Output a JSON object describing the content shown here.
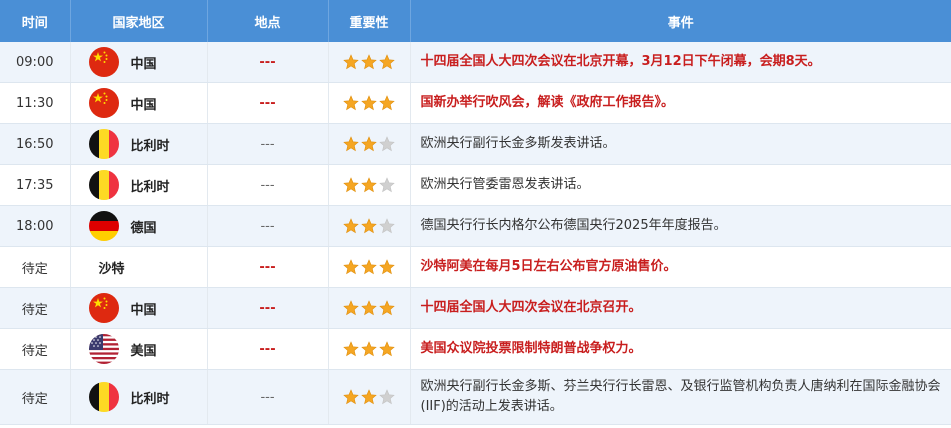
{
  "header": {
    "time": "时间",
    "country": "国家地区",
    "location": "地点",
    "importance": "重要性",
    "event": "事件"
  },
  "colors": {
    "header_bg": "#4a8fd6",
    "highlight_text": "#c81e1e",
    "star_on": "#f5a623",
    "star_off": "#d0d0d0",
    "odd_row": "#eef4fb"
  },
  "rows": [
    {
      "time": "09:00",
      "country": "中国",
      "flag": "china-flag-icon",
      "location": "---",
      "stars": 3,
      "event": "十四届全国人大四次会议在北京开幕，3月12日下午闭幕，会期8天。",
      "highlight": true
    },
    {
      "time": "11:30",
      "country": "中国",
      "flag": "china-flag-icon",
      "location": "---",
      "stars": 3,
      "event": "国新办举行吹风会，解读《政府工作报告》。",
      "highlight": true
    },
    {
      "time": "16:50",
      "country": "比利时",
      "flag": "belgium-flag-icon",
      "location": "---",
      "stars": 2,
      "event": "欧洲央行副行长金多斯发表讲话。",
      "highlight": false
    },
    {
      "time": "17:35",
      "country": "比利时",
      "flag": "belgium-flag-icon",
      "location": "---",
      "stars": 2,
      "event": "欧洲央行管委雷恩发表讲话。",
      "highlight": false
    },
    {
      "time": "18:00",
      "country": "德国",
      "flag": "germany-flag-icon",
      "location": "---",
      "stars": 2,
      "event": "德国央行行长内格尔公布德国央行2025年年度报告。",
      "highlight": false
    },
    {
      "time": "待定",
      "country": "沙特",
      "flag": "",
      "location": "---",
      "stars": 3,
      "event": "沙特阿美在每月5日左右公布官方原油售价。",
      "highlight": true
    },
    {
      "time": "待定",
      "country": "中国",
      "flag": "china-flag-icon",
      "location": "---",
      "stars": 3,
      "event": "十四届全国人大四次会议在北京召开。",
      "highlight": true
    },
    {
      "time": "待定",
      "country": "美国",
      "flag": "usa-flag-icon",
      "location": "---",
      "stars": 3,
      "event": "美国众议院投票限制特朗普战争权力。",
      "highlight": true
    },
    {
      "time": "待定",
      "country": "比利时",
      "flag": "belgium-flag-icon",
      "location": "---",
      "stars": 2,
      "event": "欧洲央行副行长金多斯、芬兰央行行长雷恩、及银行监管机构负责人唐纳利在国际金融协会(IIF)的活动上发表讲话。",
      "highlight": false
    }
  ]
}
